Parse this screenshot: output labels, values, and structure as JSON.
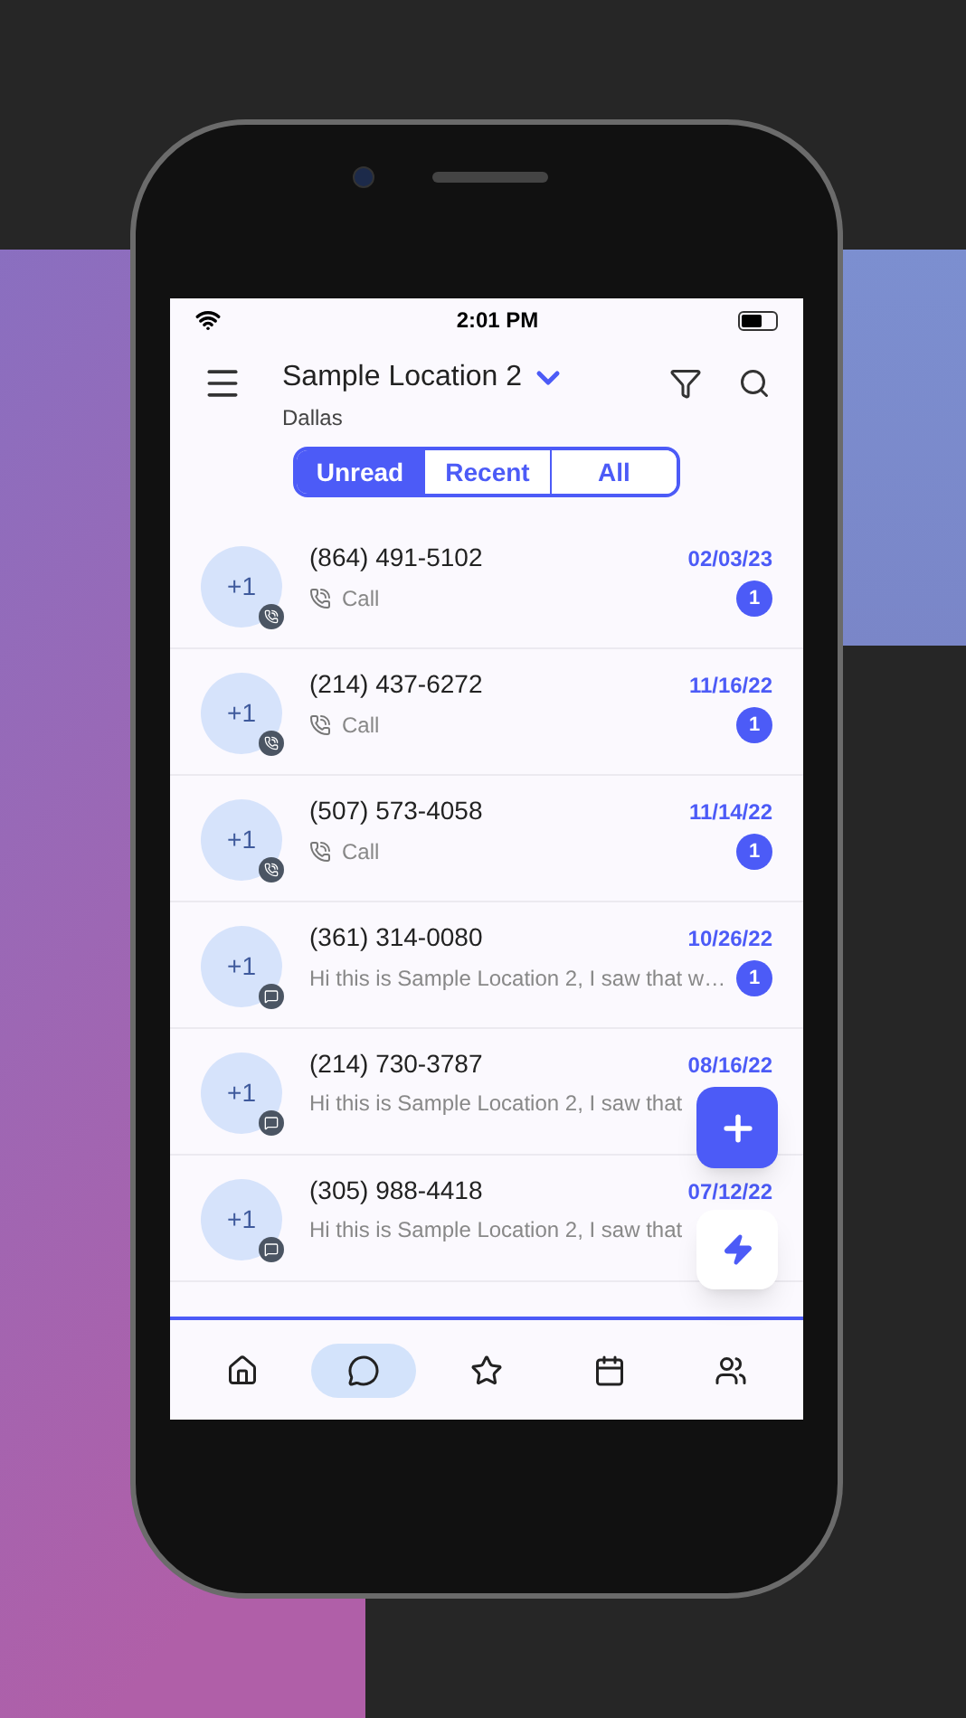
{
  "status_bar": {
    "time": "2:01 PM"
  },
  "header": {
    "title": "Sample Location 2",
    "subtitle": "Dallas"
  },
  "tabs": [
    {
      "label": "Unread",
      "selected": true
    },
    {
      "label": "Recent",
      "selected": false
    },
    {
      "label": "All",
      "selected": false
    }
  ],
  "conversations": [
    {
      "kind": "call",
      "avatar": "+1",
      "name": "(864) 491-5102",
      "preview": "Call",
      "date": "02/03/23",
      "badge": "1"
    },
    {
      "kind": "call",
      "avatar": "+1",
      "name": "(214) 437-6272",
      "preview": "Call",
      "date": "11/16/22",
      "badge": "1"
    },
    {
      "kind": "call",
      "avatar": "+1",
      "name": "(507) 573-4058",
      "preview": "Call",
      "date": "11/14/22",
      "badge": "1"
    },
    {
      "kind": "message",
      "avatar": "+1",
      "name": "(361) 314-0080",
      "preview": "Hi this is Sample Location 2, I saw that w…",
      "date": "10/26/22",
      "badge": "1"
    },
    {
      "kind": "message",
      "avatar": "+1",
      "name": "(214) 730-3787",
      "preview": "Hi this is Sample Location 2, I saw that",
      "date": "08/16/22"
    },
    {
      "kind": "message",
      "avatar": "+1",
      "name": "(305) 988-4418",
      "preview": "Hi this is Sample Location 2, I saw that",
      "date": "07/12/22"
    }
  ],
  "nav": [
    {
      "kind": "home",
      "selected": false
    },
    {
      "kind": "chat",
      "selected": true
    },
    {
      "kind": "star",
      "selected": false
    },
    {
      "kind": "calendar",
      "selected": false
    },
    {
      "kind": "people",
      "selected": false
    }
  ]
}
